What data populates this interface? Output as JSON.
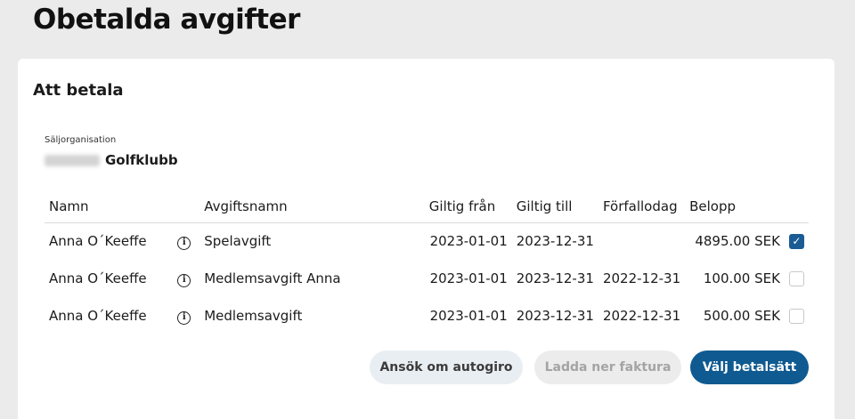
{
  "page": {
    "title": "Obetalda avgifter"
  },
  "card": {
    "title": "Att betala",
    "seller_label": "Säljorganisation",
    "seller_name": "Golfklubb"
  },
  "table": {
    "headers": {
      "name": "Namn",
      "fee_name": "Avgiftsnamn",
      "valid_from": "Giltig från",
      "valid_to": "Giltig till",
      "due_date": "Förfallodag",
      "amount": "Belopp"
    },
    "rows": [
      {
        "name": "Anna O´Keeffe",
        "fee_name": "Spelavgift",
        "valid_from": "2023-01-01",
        "valid_to": "2023-12-31",
        "due_date": "",
        "amount": "4895.00 SEK",
        "checked": true
      },
      {
        "name": "Anna O´Keeffe",
        "fee_name": "Medlemsavgift Anna",
        "valid_from": "2023-01-01",
        "valid_to": "2023-12-31",
        "due_date": "2022-12-31",
        "amount": "100.00 SEK",
        "checked": false
      },
      {
        "name": "Anna O´Keeffe",
        "fee_name": "Medlemsavgift",
        "valid_from": "2023-01-01",
        "valid_to": "2023-12-31",
        "due_date": "2022-12-31",
        "amount": "500.00 SEK",
        "checked": false
      }
    ]
  },
  "actions": {
    "autogiro_label": "Ansök om autogiro",
    "download_invoice_label": "Ladda ner faktura",
    "choose_payment_label": "Välj betalsätt"
  },
  "colors": {
    "primary": "#0f5a90",
    "background": "#ebebeb"
  },
  "icons": {
    "info": "info-icon",
    "checkbox": "checkbox"
  }
}
